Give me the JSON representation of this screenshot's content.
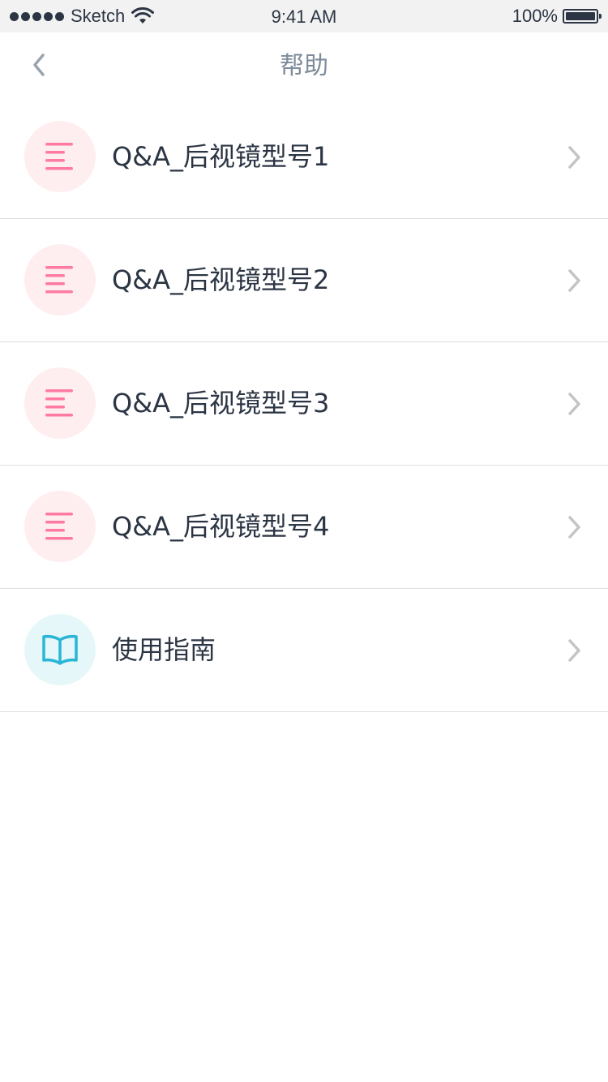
{
  "status_bar": {
    "carrier": "Sketch",
    "time": "9:41 AM",
    "battery": "100%"
  },
  "nav": {
    "title": "帮助",
    "back_icon": "chevron-left-icon"
  },
  "items": [
    {
      "label": "Q&A_后视镜型号1",
      "icon": "list-lines-icon",
      "icon_color": "#ff7aa2",
      "bg_color": "#ffeeef"
    },
    {
      "label": "Q&A_后视镜型号2",
      "icon": "list-lines-icon",
      "icon_color": "#ff7aa2",
      "bg_color": "#ffeeef"
    },
    {
      "label": "Q&A_后视镜型号3",
      "icon": "list-lines-icon",
      "icon_color": "#ff7aa2",
      "bg_color": "#ffeeef"
    },
    {
      "label": "Q&A_后视镜型号4",
      "icon": "list-lines-icon",
      "icon_color": "#ff7aa2",
      "bg_color": "#ffeeef"
    },
    {
      "label": "使用指南",
      "icon": "book-icon",
      "icon_color": "#29b6d6",
      "bg_color": "#e6f7fa"
    }
  ],
  "colors": {
    "text": "#2b3543",
    "title": "#7d8b9a",
    "chevron": "#c4c4c4",
    "divider": "#dedede"
  }
}
